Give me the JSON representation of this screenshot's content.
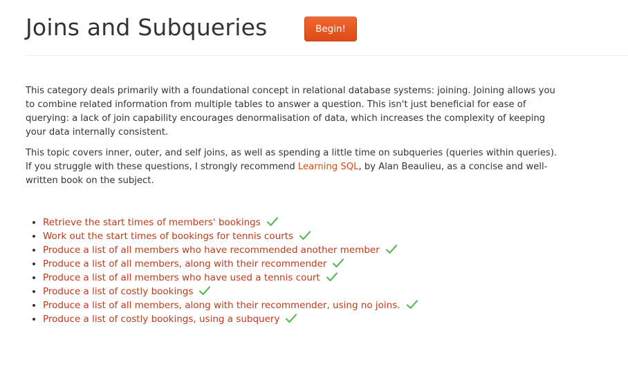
{
  "header": {
    "title": "Joins and Subqueries",
    "begin_label": "Begin!"
  },
  "intro": {
    "paragraph1": "This category deals primarily with a foundational concept in relational database systems: joining. Joining allows you to combine related information from multiple tables to answer a question. This isn't just beneficial for ease of querying: a lack of join capability encourages denormalisation of data, which increases the complexity of keeping your data internally consistent.",
    "paragraph2_before": "This topic covers inner, outer, and self joins, as well as spending a little time on subqueries (queries within queries). If you struggle with these questions, I strongly recommend ",
    "paragraph2_link": "Learning SQL",
    "paragraph2_after": ", by Alan Beaulieu, as a concise and well-written book on the subject."
  },
  "exercises": [
    {
      "label": "Retrieve the start times of members' bookings",
      "completed": true
    },
    {
      "label": "Work out the start times of bookings for tennis courts",
      "completed": true
    },
    {
      "label": "Produce a list of all members who have recommended another member",
      "completed": true
    },
    {
      "label": "Produce a list of all members, along with their recommender",
      "completed": true
    },
    {
      "label": "Produce a list of all members who have used a tennis court",
      "completed": true
    },
    {
      "label": "Produce a list of costly bookings",
      "completed": true
    },
    {
      "label": "Produce a list of all members, along with their recommender, using no joins.",
      "completed": true
    },
    {
      "label": "Produce a list of costly bookings, using a subquery",
      "completed": true
    }
  ],
  "colors": {
    "accent": "#dd4814",
    "link": "#c0391b",
    "check": "#5cb85c"
  },
  "icons": {
    "completed": "check-icon"
  }
}
